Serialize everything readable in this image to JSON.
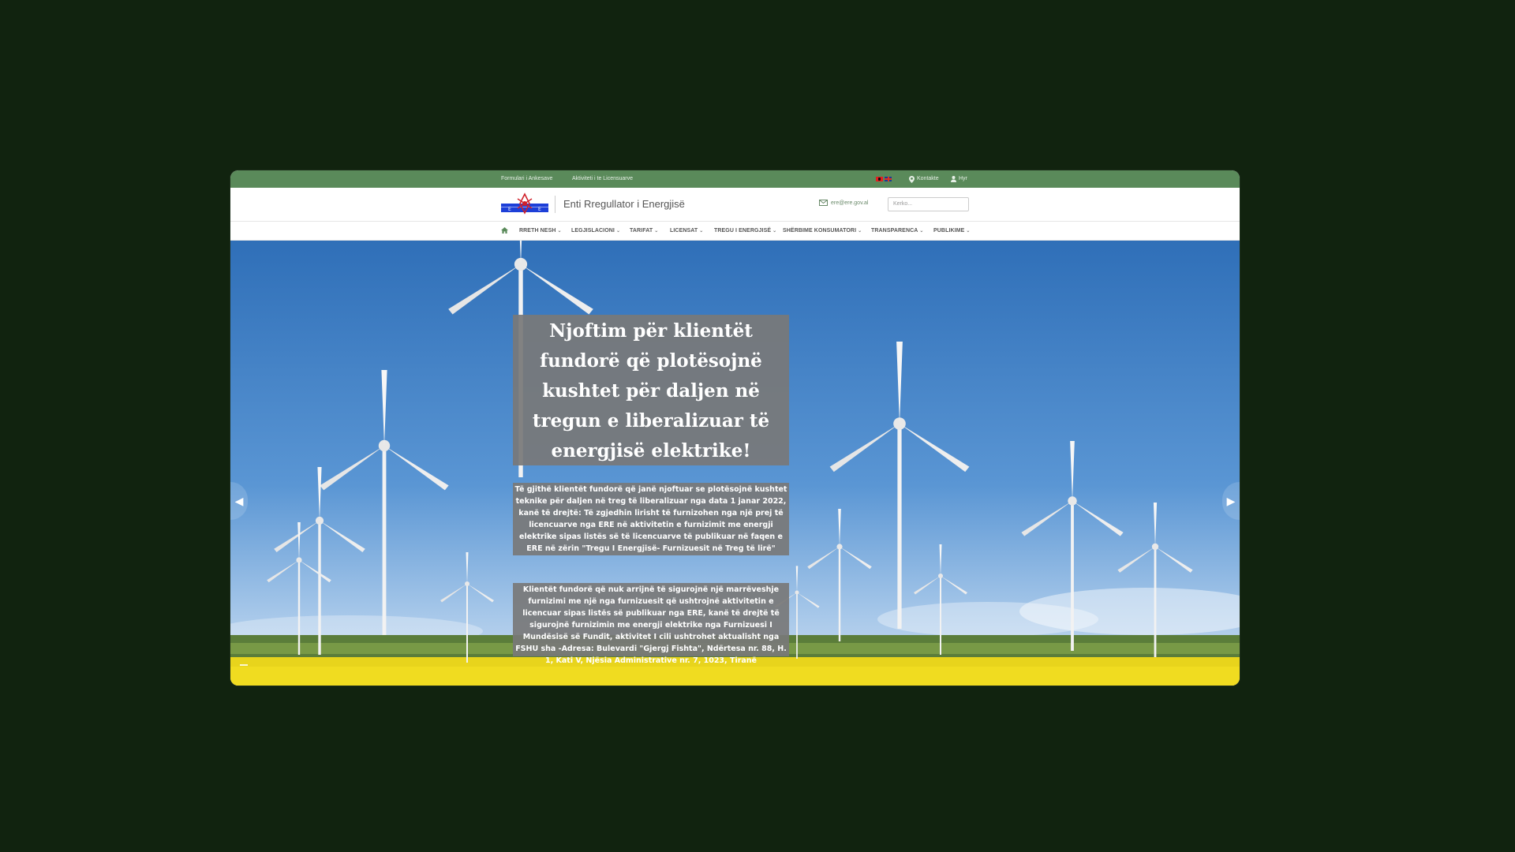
{
  "topbar": {
    "link_forms": "Formulari i Ankesave",
    "link_activity": "Aktiviteti i te Licensuarve",
    "flags": [
      "flag-al-icon",
      "flag-en-icon"
    ],
    "contact_label": "Kontakte",
    "login_label": "Hyr"
  },
  "header": {
    "site_title": "Enti Rregullator i Energjisë",
    "email": "ere@ere.gov.al",
    "search_placeholder": "Kerko..."
  },
  "nav": {
    "items": [
      "RRETH NESH",
      "LEGJISLACIONI",
      "TARIFAT",
      "LICENSAT",
      "TREGU I ENERGJISË",
      "SHËRBIME KONSUMATORI",
      "TRANSPARENCA",
      "PUBLIKIME"
    ]
  },
  "hero": {
    "headline": "Njoftim për klientët fundorë që plotësojnë kushtet për daljen në tregun e liberalizuar të energjisë elektrike!",
    "paragraph_1": "Të gjithë klientët fundorë që janë njoftuar se plotësojnë kushtet teknike për daljen në treg të liberalizuar nga data 1 janar 2022, kanë të drejtë: Të zgjedhin lirisht të furnizohen nga një prej të licencuarve nga ERE në aktivitetin e furnizimit me energji elektrike sipas listës së të licencuarve të publikuar në faqen e ERE në zërin \"Tregu I Energjisë- Furnizuesit në Treg të lirë\"",
    "paragraph_2": "Klientët fundorë që nuk arrijnë të sigurojnë një marrëveshje furnizimi me një nga furnizuesit që ushtrojnë aktivitetin e licencuar sipas listës së publikuar nga ERE, kanë të drejtë të sigurojnë furnizimin me energji elektrike nga Furnizuesi I Mundësisë së Fundit, aktivitet I cili ushtrohet aktualisht nga FSHU sha -Adresa: Bulevardi \"Gjergj Fishta\", Ndërtesa nr. 88, H. 1, Kati V, Njësia Administrative nr. 7, 1023, Tiranë"
  },
  "colors": {
    "topbar": "#5a8a5a",
    "page_background": "#11230f",
    "overlay": "#787878"
  }
}
